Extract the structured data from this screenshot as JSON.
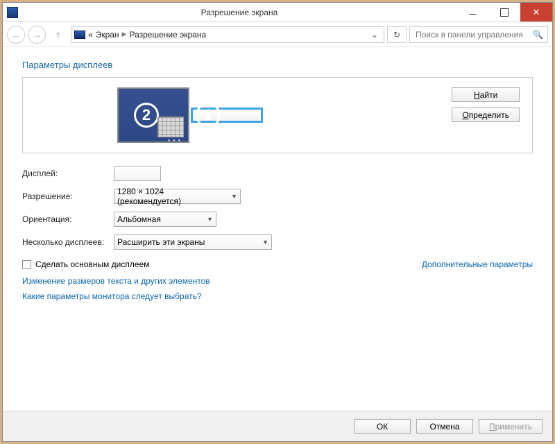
{
  "window": {
    "title": "Разрешение экрана"
  },
  "breadcrumb": {
    "prefix": "«",
    "parent": "Экран",
    "current": "Разрешение экрана"
  },
  "search": {
    "placeholder": "Поиск в панели управления"
  },
  "heading": "Параметры дисплеев",
  "monitors": {
    "mon2_num": "2",
    "mon1_num": "1"
  },
  "buttons": {
    "find": "Найти",
    "find_u": "Н",
    "find_rest": "айти",
    "identify": "Определить",
    "identify_u": "О",
    "identify_rest": "пределить"
  },
  "form": {
    "display_label": "Дисплей:",
    "resolution_label": "Разрешение:",
    "resolution_value": "1280 × 1024 (рекомендуется)",
    "orientation_label": "Ориентация:",
    "orientation_value": "Альбомная",
    "multi_label": "Несколько дисплеев:",
    "multi_value": "Расширить эти экраны"
  },
  "checkbox": {
    "label": "Сделать основным дисплеем"
  },
  "adv_link": "Дополнительные параметры",
  "links": {
    "text_size": "Изменение размеров текста и других элементов",
    "help": "Какие параметры монитора следует выбрать?"
  },
  "footer": {
    "ok": "ОК",
    "cancel": "Отмена",
    "apply": "Применить",
    "apply_u": "П",
    "apply_rest": "рименить"
  }
}
